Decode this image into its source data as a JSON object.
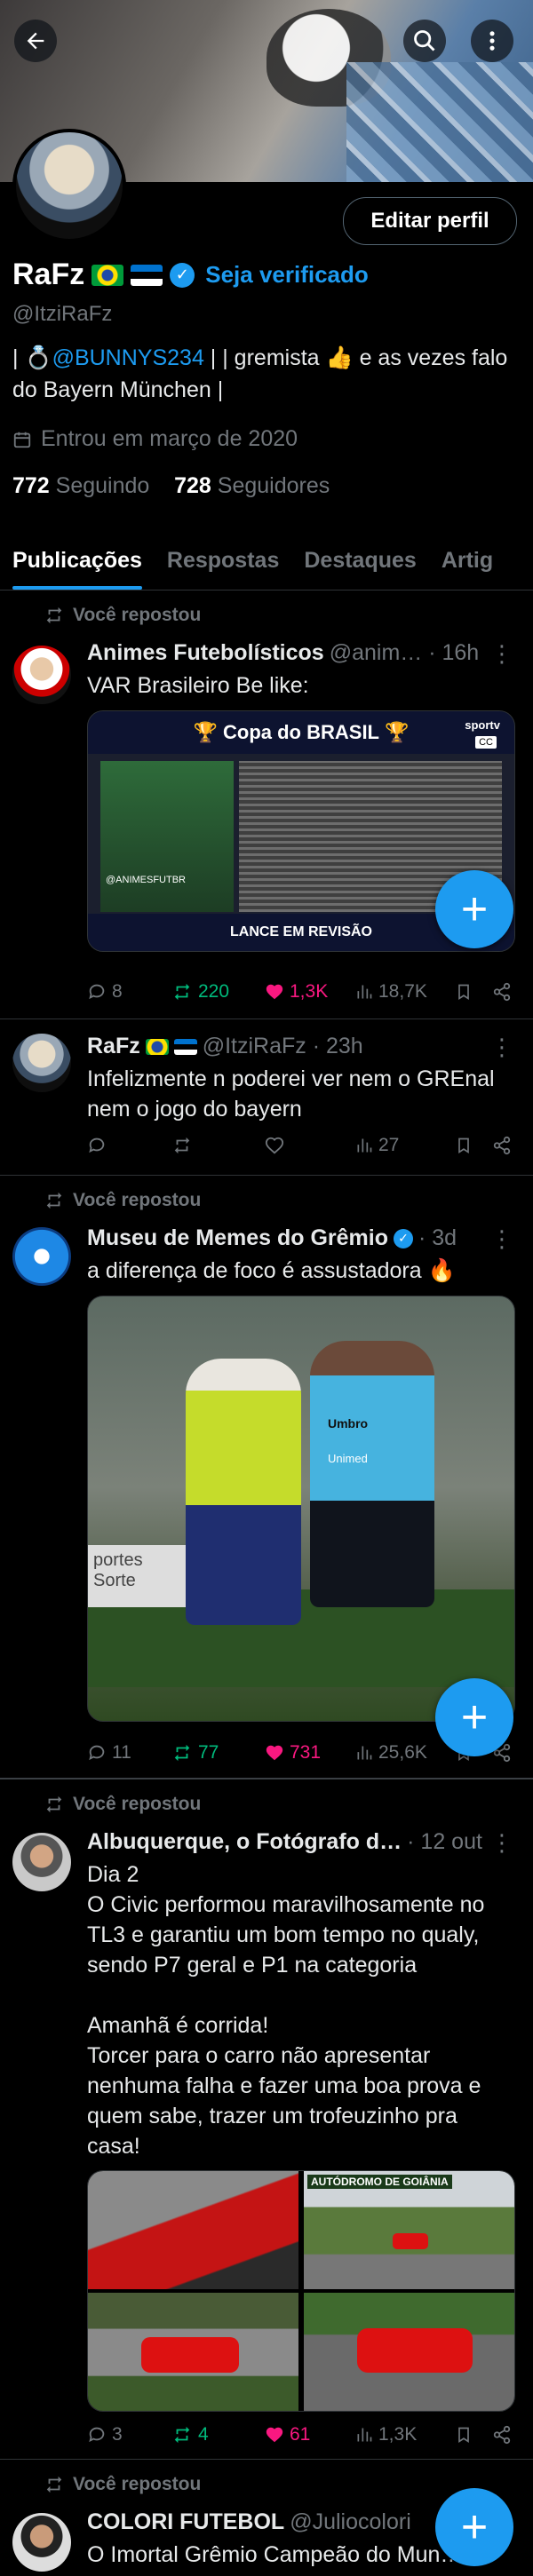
{
  "header": {
    "edit_profile": "Editar perfil",
    "display_name": "RaFz",
    "verify_label": "Seja verificado",
    "handle": "@ItziRaFz",
    "bio_prefix": "| 💍",
    "bio_mention": "@BUNNYS234",
    "bio_suffix": " |  | gremista 👍 e as vezes falo do Bayern München |",
    "joined": "Entrou em março de 2020",
    "following_count": "772",
    "following_label": "Seguindo",
    "followers_count": "728",
    "followers_label": "Seguidores"
  },
  "tabs": [
    "Publicações",
    "Respostas",
    "Destaques",
    "Artig"
  ],
  "posts": [
    {
      "repost_label": "Você repostou",
      "name": "Animes Futebolísticos",
      "meta": "@anim… · 16h",
      "text": "VAR Brasileiro Be like:",
      "media": {
        "cup_title": "Copa do BRASIL",
        "tag": "@ANIMESFUTBR",
        "footer": "LANCE EM REVISÃO",
        "corner": "sportv",
        "cc": "CC"
      },
      "replies": "8",
      "reposts": "220",
      "likes": "1,3K",
      "views": "18,7K"
    },
    {
      "name": "RaFz",
      "meta": "@ItziRaFz · 23h",
      "text": "Infelizmente n poderei ver nem o GREnal nem o jogo do bayern",
      "replies": "",
      "reposts": "",
      "likes": "",
      "views": "27"
    },
    {
      "repost_label": "Você repostou",
      "name": "Museu de Memes do Grêmio",
      "meta": "· 3d",
      "text": "a diferença de foco é assustadora 🔥",
      "media": {
        "shirt1": "Umbro",
        "shirt2": "Unimed",
        "board": "portes Sorte"
      },
      "replies": "11",
      "reposts": "77",
      "likes": "731",
      "views": "25,6K"
    },
    {
      "repost_label": "Você repostou",
      "name": "Albuquerque, o Fotógrafo d…",
      "meta": "· 12 out",
      "text": "Dia 2\nO Civic performou maravilhosamente no TL3 e garantiu um bom tempo no qualy, sendo P7 geral e P1 na categoria\n\nAmanhã é corrida!\nTorcer para o carro não apresentar nenhuma falha e fazer uma boa prova e quem sabe, trazer um trofeuzinho pra casa!",
      "media": {
        "sign": "AUTÓDROMO DE GOIÂNIA"
      },
      "replies": "3",
      "reposts": "4",
      "likes": "61",
      "views": "1,3K"
    },
    {
      "repost_label": "Você repostou",
      "name": "COLORI FUTEBOL",
      "meta": "@Juliocolori",
      "text": "O Imortal Grêmio Campeão do Mun…"
    }
  ],
  "colors": {
    "accent": "#1d9bf0",
    "repost_green": "#00ba7c",
    "like_pink": "#f91880",
    "muted": "#71767b"
  }
}
